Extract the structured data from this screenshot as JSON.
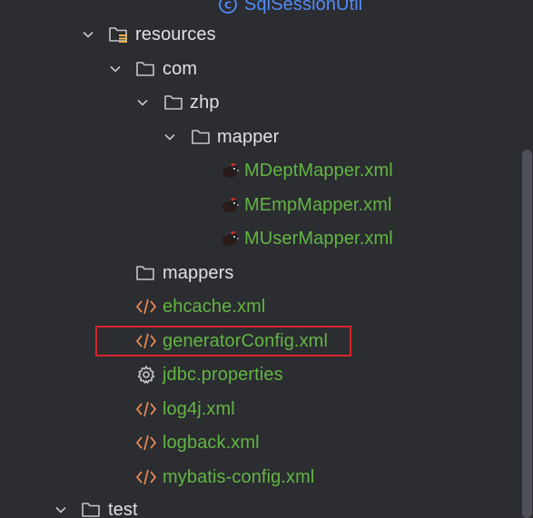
{
  "tree": {
    "rows": [
      {
        "label": "SqlSessionUtil",
        "icon": "class-icon",
        "color": "#548af7"
      },
      {
        "label": "resources",
        "icon": "resources-folder-icon",
        "expanded": true
      },
      {
        "label": "com",
        "icon": "folder-icon",
        "expanded": true
      },
      {
        "label": "zhp",
        "icon": "folder-icon",
        "expanded": true
      },
      {
        "label": "mapper",
        "icon": "folder-icon",
        "expanded": true
      },
      {
        "label": "MDeptMapper.xml",
        "icon": "mybatis-bird-icon",
        "color": "#62b543"
      },
      {
        "label": "MEmpMapper.xml",
        "icon": "mybatis-bird-icon",
        "color": "#62b543"
      },
      {
        "label": "MUserMapper.xml",
        "icon": "mybatis-bird-icon",
        "color": "#62b543"
      },
      {
        "label": "mappers",
        "icon": "folder-icon",
        "expanded": false
      },
      {
        "label": "ehcache.xml",
        "icon": "xml-code-icon",
        "color": "#62b543"
      },
      {
        "label": "generatorConfig.xml",
        "icon": "xml-code-icon",
        "color": "#62b543",
        "highlighted": true
      },
      {
        "label": "jdbc.properties",
        "icon": "gear-icon",
        "color": "#62b543"
      },
      {
        "label": "log4j.xml",
        "icon": "xml-code-icon",
        "color": "#62b543"
      },
      {
        "label": "logback.xml",
        "icon": "xml-code-icon",
        "color": "#62b543"
      },
      {
        "label": "mybatis-config.xml",
        "icon": "xml-code-icon",
        "color": "#62b543"
      },
      {
        "label": "test",
        "icon": "folder-icon",
        "expanded": true
      }
    ]
  },
  "colors": {
    "background": "#2b2d30",
    "text_default": "#dfe1e5",
    "text_vcs_added": "#62b543",
    "text_class": "#548af7",
    "xml_icon": "#e08855",
    "highlight_border": "#d7262c"
  }
}
